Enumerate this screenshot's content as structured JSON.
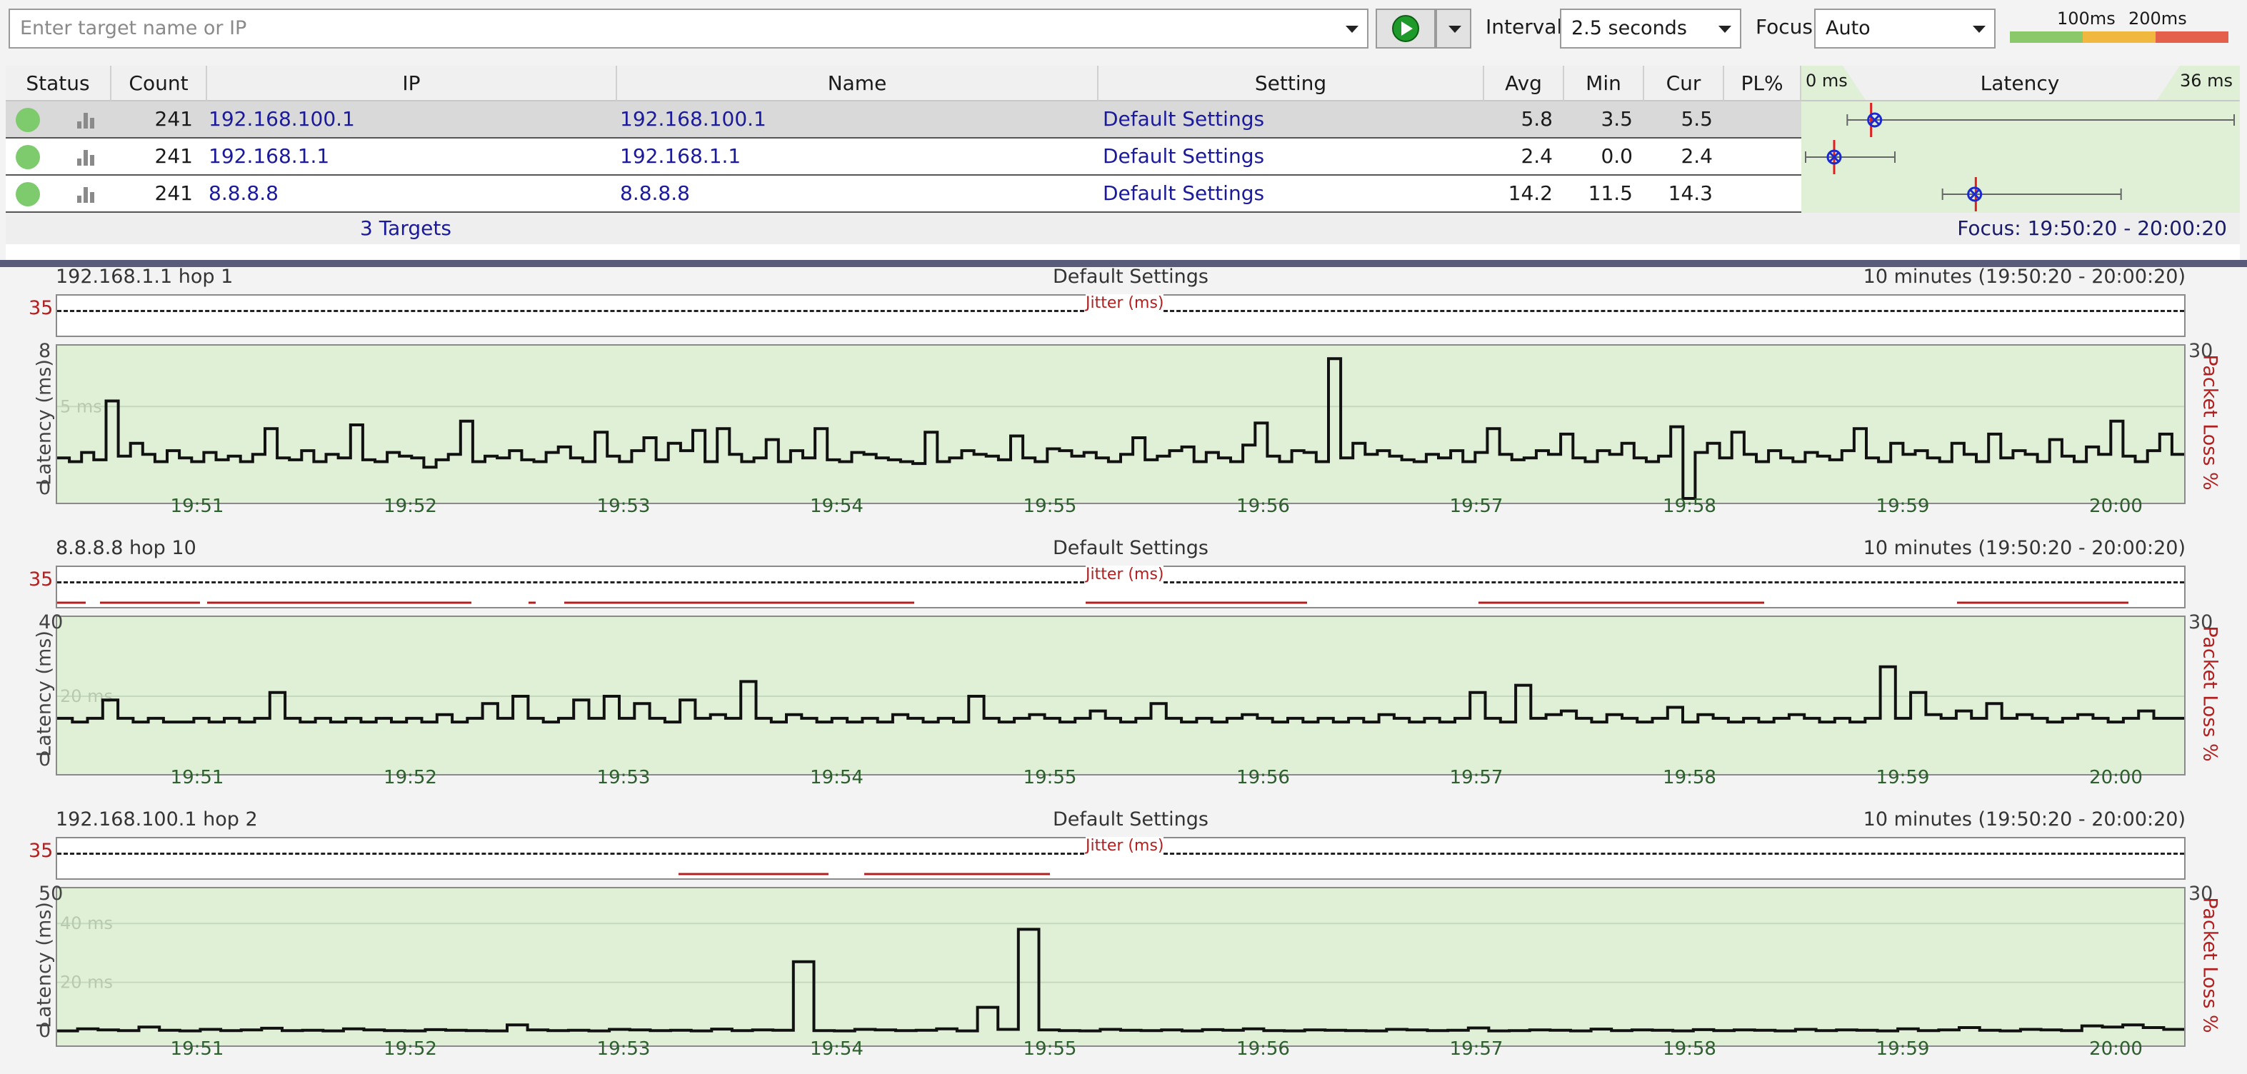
{
  "toolbar": {
    "target_placeholder": "Enter target name or IP",
    "interval_label": "Interval",
    "interval_value": "2.5 seconds",
    "focus_label": "Focus",
    "focus_value": "Auto",
    "scale_labels": [
      "100ms",
      "200ms"
    ]
  },
  "grid": {
    "headers": [
      "Status",
      "Count",
      "IP",
      "Name",
      "Setting",
      "Avg",
      "Min",
      "Cur",
      "PL%",
      "Latency"
    ],
    "latency_min_label": "0 ms",
    "latency_max_label": "36 ms",
    "rows": [
      {
        "count": "241",
        "ip": "192.168.100.1",
        "name": "192.168.100.1",
        "setting": "Default Settings",
        "avg": "5.8",
        "min": "3.5",
        "cur": "5.5",
        "pl": "",
        "lat": {
          "min": 3.5,
          "avg": 5.8,
          "cur": 5.5,
          "max": 36
        }
      },
      {
        "count": "241",
        "ip": "192.168.1.1",
        "name": "192.168.1.1",
        "setting": "Default Settings",
        "avg": "2.4",
        "min": "0.0",
        "cur": "2.4",
        "pl": "",
        "lat": {
          "min": 0.0,
          "avg": 2.4,
          "cur": 2.4,
          "max": 7.5
        }
      },
      {
        "count": "241",
        "ip": "8.8.8.8",
        "name": "8.8.8.8",
        "setting": "Default Settings",
        "avg": "14.2",
        "min": "11.5",
        "cur": "14.3",
        "pl": "",
        "lat": {
          "min": 11.5,
          "avg": 14.2,
          "cur": 14.3,
          "max": 26.5
        }
      }
    ],
    "footer_targets": "3 Targets",
    "footer_focus": "Focus: 19:50:20 - 20:00:20"
  },
  "panels": [
    {
      "title_left": "192.168.1.1 hop 1",
      "title_center": "Default Settings",
      "title_right": "10 minutes (19:50:20 - 20:00:20)",
      "jitter_label": "Jitter (ms)",
      "jitter_max": "35",
      "ymax": "8",
      "ymin": "0",
      "gridline_label": "5 ms",
      "yaxis_label": "Latency (ms)",
      "y2_label": "Packet Loss %",
      "y2_max": "30"
    },
    {
      "title_left": "8.8.8.8 hop 10",
      "title_center": "Default Settings",
      "title_right": "10 minutes (19:50:20 - 20:00:20)",
      "jitter_label": "Jitter (ms)",
      "jitter_max": "35",
      "ymax": "40",
      "ymin": "0",
      "gridline_label": "20 ms",
      "yaxis_label": "Latency (ms)",
      "y2_label": "Packet Loss %",
      "y2_max": "30"
    },
    {
      "title_left": "192.168.100.1 hop 2",
      "title_center": "Default Settings",
      "title_right": "10 minutes (19:50:20 - 20:00:20)",
      "jitter_label": "Jitter (ms)",
      "jitter_max": "35",
      "ymax": "50",
      "ymin": "0",
      "gridline_label": "40 ms",
      "gridline_label2": "20 ms",
      "yaxis_label": "Latency (ms)",
      "y2_label": "Packet Loss %",
      "y2_max": "30"
    }
  ],
  "time_ticks": [
    "19:51",
    "19:52",
    "19:53",
    "19:54",
    "19:55",
    "19:56",
    "19:57",
    "19:58",
    "19:59",
    "20:00"
  ],
  "colors": {
    "plot_bg": "#dff0d6",
    "status_ok": "#7ecb6e",
    "divider": "#595b7a",
    "jitter_line": "#b02020"
  },
  "chart_data": [
    {
      "type": "line",
      "series": [
        {
          "name": "192.168.1.1 hop 1",
          "x_range": [
            "19:50:20",
            "20:00:20"
          ],
          "values": [
            2.2,
            2.0,
            2.5,
            2.1,
            5.3,
            2.3,
            3.0,
            2.4,
            2.0,
            2.6,
            2.2,
            2.0,
            2.5,
            2.1,
            2.3,
            2.0,
            2.4,
            3.8,
            2.2,
            2.1,
            2.6,
            2.0,
            2.4,
            2.2,
            4.0,
            2.1,
            2.0,
            2.5,
            2.3,
            2.2,
            1.7,
            2.1,
            2.4,
            4.2,
            2.0,
            2.3,
            2.2,
            2.6,
            2.1,
            2.0,
            2.5,
            2.8,
            2.2,
            2.0,
            3.6,
            2.3,
            2.0,
            2.6,
            3.3,
            2.1,
            3.0,
            2.6,
            3.7,
            2.0,
            3.8,
            2.4,
            2.0,
            2.2,
            3.2,
            2.0,
            2.6,
            2.2,
            3.8,
            2.1,
            2.0,
            2.5,
            2.4,
            2.2,
            2.1,
            2.0,
            1.9,
            3.6,
            2.0,
            2.2,
            2.6,
            2.4,
            2.3,
            2.1,
            3.4,
            2.2,
            2.0,
            2.7,
            2.6,
            2.3,
            2.5,
            2.2,
            2.0,
            2.4,
            3.3,
            2.1,
            2.3,
            2.6,
            2.8,
            2.0,
            2.5,
            2.2,
            2.0,
            2.9,
            4.1,
            2.3,
            2.0,
            2.6,
            2.5,
            2.0,
            7.6,
            2.2,
            3.0,
            2.4,
            2.6,
            2.3,
            2.1,
            2.0,
            2.4,
            2.2,
            2.6,
            2.0,
            2.5,
            3.8,
            2.4,
            2.1,
            2.2,
            2.6,
            2.4,
            3.5,
            2.2,
            2.0,
            2.6,
            2.4,
            3.0,
            2.2,
            2.0,
            2.3,
            3.9,
            0.0,
            2.5,
            3.0,
            2.2,
            3.6,
            2.4,
            2.0,
            2.6,
            2.2,
            2.0,
            2.5,
            2.3,
            2.1,
            2.6,
            3.8,
            2.2,
            2.0,
            3.0,
            2.4,
            2.6,
            2.2,
            2.0,
            3.0,
            2.4,
            2.0,
            3.5,
            2.2,
            2.6,
            2.4,
            2.0,
            3.2,
            2.3,
            2.0,
            2.8,
            2.4,
            4.2,
            2.3,
            2.0,
            2.6,
            3.5,
            2.4
          ]
        }
      ]
    },
    {
      "type": "line",
      "series": [
        {
          "name": "8.8.8.8 hop 10",
          "x_range": [
            "19:50:20",
            "20:00:20"
          ],
          "values": [
            14,
            13,
            14,
            19,
            14,
            13,
            14,
            13,
            13,
            14,
            13,
            14,
            13,
            14,
            21,
            14,
            13,
            14,
            13,
            14,
            13,
            14,
            13,
            14,
            13,
            15,
            13,
            14,
            18,
            14,
            20,
            14,
            13,
            14,
            19,
            14,
            20,
            14,
            18,
            14,
            13,
            19,
            14,
            15,
            14,
            24,
            14,
            13,
            15,
            14,
            13,
            14,
            13,
            14,
            13,
            15,
            14,
            13,
            14,
            13,
            20,
            14,
            13,
            14,
            15,
            14,
            13,
            14,
            16,
            14,
            13,
            14,
            18,
            14,
            13,
            14,
            13,
            14,
            15,
            14,
            13,
            14,
            13,
            14,
            13,
            14,
            13,
            15,
            14,
            13,
            14,
            13,
            14,
            21,
            14,
            13,
            23,
            14,
            15,
            16,
            14,
            13,
            15,
            14,
            13,
            14,
            17,
            13,
            15,
            14,
            13,
            14,
            13,
            14,
            15,
            14,
            13,
            14,
            13,
            14,
            28,
            14,
            21,
            15,
            14,
            16,
            14,
            18,
            14,
            15,
            14,
            13,
            14,
            15,
            14,
            13,
            14,
            16,
            14,
            14
          ]
        }
      ]
    },
    {
      "type": "line",
      "series": [
        {
          "name": "192.168.100.1 hop 2",
          "x_range": [
            "19:50:20",
            "20:00:20"
          ],
          "values": [
            3.5,
            4.2,
            3.8,
            3.6,
            4.8,
            3.7,
            3.5,
            4.0,
            3.6,
            3.8,
            4.4,
            3.6,
            3.7,
            3.5,
            4.2,
            3.8,
            3.6,
            3.5,
            3.9,
            3.7,
            3.6,
            3.5,
            5.5,
            3.8,
            3.6,
            3.7,
            3.5,
            4.0,
            3.8,
            3.6,
            3.7,
            3.5,
            4.1,
            3.6,
            3.8,
            3.7,
            27.0,
            3.6,
            3.5,
            4.0,
            3.8,
            3.6,
            3.7,
            4.2,
            3.5,
            11.5,
            4.0,
            38.0,
            3.8,
            3.6,
            3.5,
            4.0,
            3.7,
            3.6,
            3.8,
            3.5,
            3.9,
            3.7,
            4.2,
            3.6,
            3.5,
            3.8,
            3.7,
            3.6,
            3.5,
            4.0,
            3.8,
            3.6,
            3.7,
            4.5,
            3.5,
            3.6,
            3.8,
            3.7,
            3.5,
            4.1,
            3.6,
            3.8,
            3.7,
            3.5,
            3.9,
            3.6,
            3.8,
            3.7,
            3.5,
            4.0,
            3.6,
            3.8,
            3.7,
            3.5,
            4.2,
            3.6,
            3.8,
            4.6,
            3.7,
            3.5,
            4.0,
            3.8,
            3.6,
            5.2,
            4.8,
            5.5,
            4.6,
            4.0
          ]
        }
      ]
    }
  ]
}
